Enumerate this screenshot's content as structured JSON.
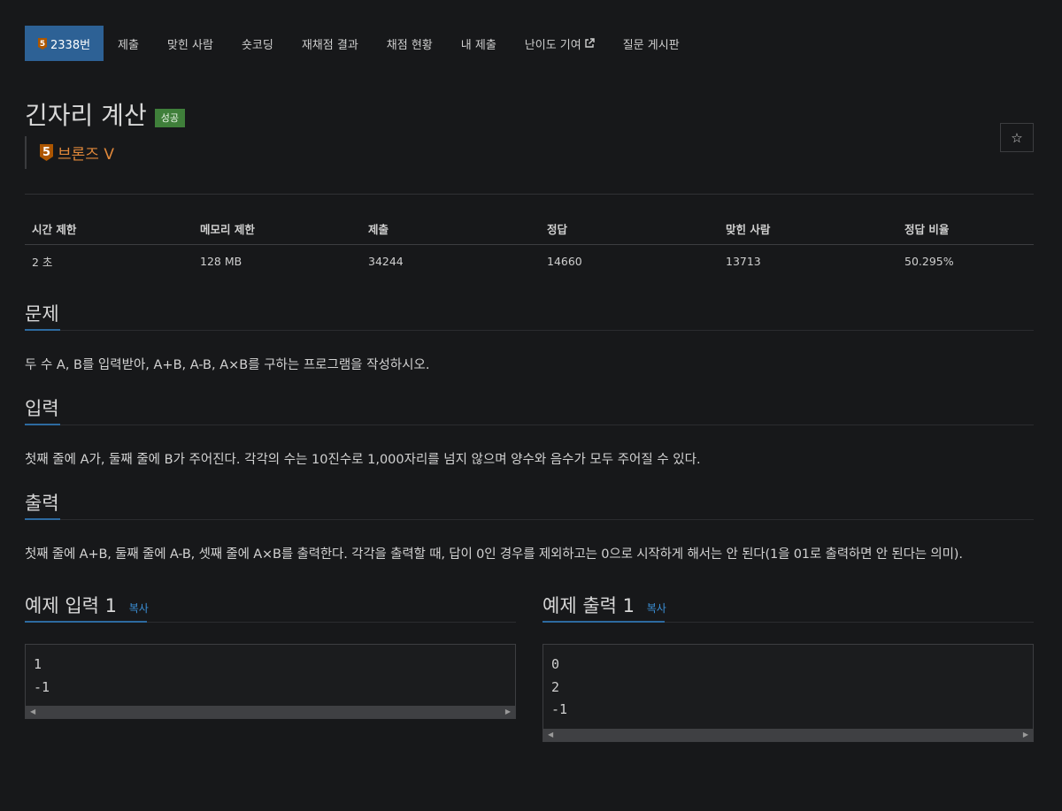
{
  "nav": {
    "tabs": [
      {
        "label": "2338번",
        "active": true,
        "tier_icon": "5"
      },
      {
        "label": "제출"
      },
      {
        "label": "맞힌 사람"
      },
      {
        "label": "숏코딩"
      },
      {
        "label": "재채점 결과"
      },
      {
        "label": "채점 현황"
      },
      {
        "label": "내 제출"
      },
      {
        "label": "난이도 기여",
        "external": true
      },
      {
        "label": "질문 게시판"
      }
    ]
  },
  "problem": {
    "title": "긴자리 계산",
    "status_badge": "성공",
    "tier": {
      "number": "5",
      "label": "브론즈 V"
    },
    "star_icon": "☆"
  },
  "info_table": {
    "headers": [
      "시간 제한",
      "메모리 제한",
      "제출",
      "정답",
      "맞힌 사람",
      "정답 비율"
    ],
    "values": [
      "2 초",
      "128 MB",
      "34244",
      "14660",
      "13713",
      "50.295%"
    ]
  },
  "sections": {
    "problem": {
      "heading": "문제",
      "text": "두 수 A, B를 입력받아, A+B, A-B, A×B를 구하는 프로그램을 작성하시오."
    },
    "input": {
      "heading": "입력",
      "text": "첫째 줄에 A가, 둘째 줄에 B가 주어진다. 각각의 수는 10진수로 1,000자리를 넘지 않으며 양수와 음수가 모두 주어질 수 있다."
    },
    "output": {
      "heading": "출력",
      "text": "첫째 줄에 A+B, 둘째 줄에 A-B, 셋째 줄에 A×B를 출력한다. 각각을 출력할 때, 답이 0인 경우를 제외하고는 0으로 시작하게 해서는 안 된다(1을 01로 출력하면 안 된다는 의미)."
    }
  },
  "samples": {
    "input": {
      "heading": "예제 입력 1",
      "copy_label": "복사",
      "content": "1\n-1"
    },
    "output": {
      "heading": "예제 출력 1",
      "copy_label": "복사",
      "content": "0\n2\n-1"
    }
  },
  "colors": {
    "background": "#17181a",
    "nav_active": "#2d6195",
    "success_badge": "#3f7f3a",
    "bronze": "#e1883a",
    "link": "#3b8fd6"
  }
}
